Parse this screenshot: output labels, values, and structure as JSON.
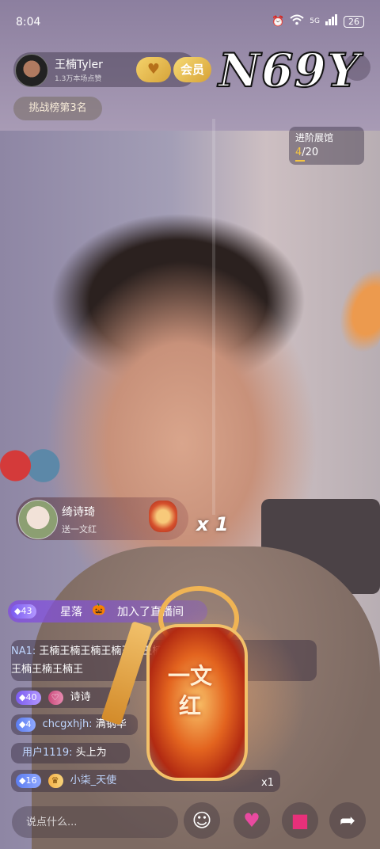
{
  "status_bar": {
    "time": "8:04",
    "battery": "26",
    "network": "5G"
  },
  "host": {
    "name": "王楠Tyler",
    "subtitle": "1.3万本场点赞",
    "like_icon": "heart-gold-icon",
    "vip_label": "会员"
  },
  "rank_label": "挑战榜第3名",
  "watermark": "N69Y",
  "pavilion": {
    "title": "进阶展馆",
    "current": "4",
    "total": "/20",
    "progress_fraction": 0.2
  },
  "gift_toast": {
    "user": "绮诗琦",
    "description": "送一文红",
    "count": "x 1"
  },
  "join_bar": {
    "level": "43",
    "user": "星落",
    "text": "加入了直播间"
  },
  "chat": [
    {
      "badge": "",
      "user": "NA1:",
      "text": "王楠王楠王楠王楠王楠王楠王楠王楠"
    },
    {
      "badge": "",
      "user": "",
      "text": "王楠王楠王楠王"
    },
    {
      "badge": "40",
      "user": "",
      "text": "诗诗"
    },
    {
      "badge": "4",
      "user": "chcgxhjh:",
      "text": "满钢华"
    },
    {
      "badge": "",
      "user": "用户1119:",
      "text": "头上为"
    },
    {
      "badge": "16",
      "user": "小柒_天使",
      "text": "x1"
    }
  ],
  "pendant_text": "一文红",
  "input": {
    "placeholder": "说点什么..."
  },
  "colors": {
    "accent_purple": "#7b5cf0",
    "gold": "#f5c542",
    "pink": "#e84aa0"
  }
}
